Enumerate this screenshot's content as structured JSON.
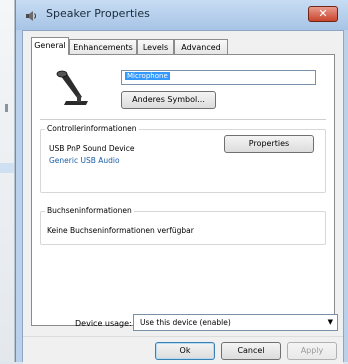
{
  "window": {
    "title": "Speaker Properties",
    "close_glyph": "✕"
  },
  "tabs": [
    {
      "label": "General",
      "active": true
    },
    {
      "label": "Enhancements",
      "active": false
    },
    {
      "label": "Levels",
      "active": false
    },
    {
      "label": "Advanced",
      "active": false
    }
  ],
  "device": {
    "name_value": "Microphone",
    "change_icon_button": "Anderes Symbol..."
  },
  "controller": {
    "legend": "Controllerinformationen",
    "device_name": "USB PnP Sound Device",
    "driver_link": "Generic USB Audio",
    "properties_button": "Properties"
  },
  "jacks": {
    "legend": "Buchseninformationen",
    "text": "Keine Buchseninformationen verfügbar"
  },
  "usage": {
    "label": "Device usage:",
    "selected": "Use this device (enable)",
    "arrow": "▼"
  },
  "footer": {
    "ok": "Ok",
    "cancel": "Cancel",
    "apply": "Apply"
  },
  "icons": {
    "title": "speaker-icon",
    "device": "microphone-icon"
  }
}
